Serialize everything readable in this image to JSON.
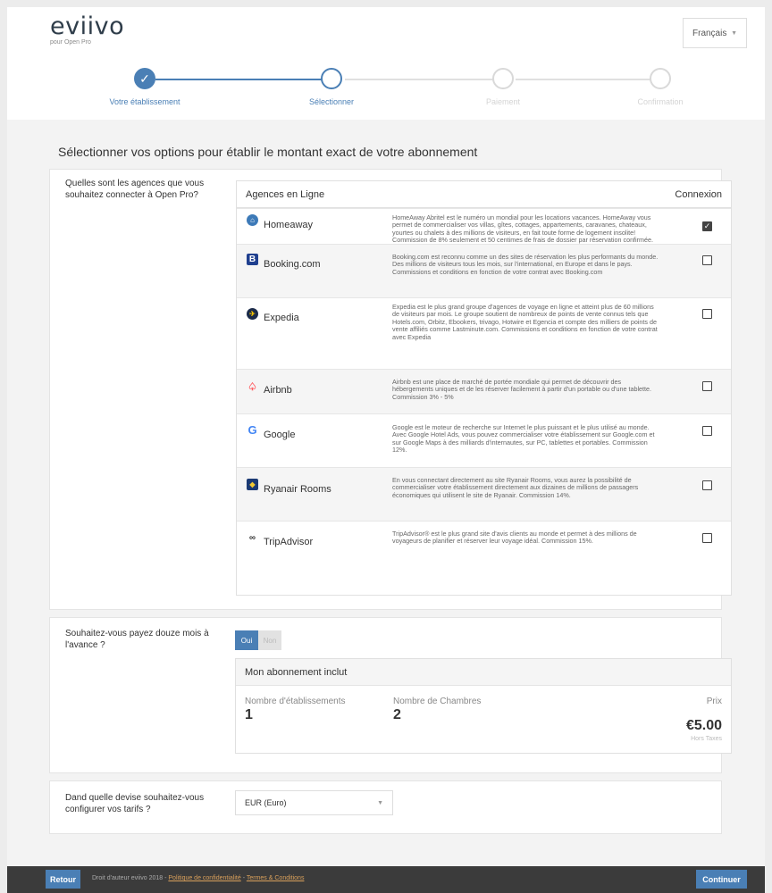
{
  "header": {
    "logo": "eviivo",
    "logo_sub": "pour Open Pro",
    "language": "Français"
  },
  "stepper": {
    "steps": [
      {
        "label": "Votre établissement",
        "state": "done"
      },
      {
        "label": "Sélectionner",
        "state": "active"
      },
      {
        "label": "Paiement",
        "state": "todo"
      },
      {
        "label": "Confirmation",
        "state": "todo"
      }
    ],
    "accent_color": "#4a7fb5"
  },
  "page_title": "Sélectionner vos options pour établir le montant exact de votre abonnement",
  "agencies": {
    "question": "Quelles sont les agences que vous souhaitez connecter à Open Pro?",
    "header_name": "Agences en Ligne",
    "header_connect": "Connexion",
    "items": [
      {
        "name": "Homeaway",
        "icon": "homeaway-icon",
        "checked": true,
        "description": "HomeAway Abritel est le numéro un mondial pour les locations vacances. HomeAway vous permet de commercialiser vos villas, gîtes, cottages, appartements, caravanes, chateaux, yourtes ou chalets à des millions de visiteurs, en fait toute forme de logement insolite! Commission de 8% seulement et 50 centimes de frais de dossier par réservation confirmée."
      },
      {
        "name": "Booking.com",
        "icon": "booking-icon",
        "checked": false,
        "description": "Booking.com est reconnu comme un des sites de réservation les plus performants du monde. Des millions de visiteurs tous les mois, sur l'international, en Europe et dans le pays. Commissions et conditions en fonction de votre contrat avec Booking.com"
      },
      {
        "name": "Expedia",
        "icon": "expedia-icon",
        "checked": false,
        "description": "Expedia est le plus grand groupe d'agences de voyage en ligne et atteint plus de 60 millions de visiteurs par mois. Le groupe soutient de nombreux de points de vente connus tels que Hotels.com, Orbitz, Ebookers, trivago, Hotwire et Egencia et compte des milliers de points de vente affiliés comme Lastminute.com. Commissions et conditions en fonction de votre contrat avec Expedia"
      },
      {
        "name": "Airbnb",
        "icon": "airbnb-icon",
        "checked": false,
        "description": "Airbnb est une place de marché de portée mondiale qui permet de découvrir des hébergements uniques et de les réserver facilement à partir d'un portable ou d'une tablette. Commission 3% - 5%"
      },
      {
        "name": "Google",
        "icon": "google-icon",
        "checked": false,
        "description": "Google est le moteur de recherche sur Internet le plus puissant et le plus utilisé au monde. Avec Google Hotel Ads, vous pouvez commercialiser votre établissement sur Google.com et sur Google Maps à des milliards d'internautes, sur PC, tablettes et portables. Commission 12%."
      },
      {
        "name": "Ryanair Rooms",
        "icon": "ryanair-icon",
        "checked": false,
        "description": "En vous connectant directement au site Ryanair Rooms, vous aurez la possibilité de commercialiser votre établissement directement aux dizaines de millions de passagers économiques qui utilisent le site de Ryanair. Commission 14%."
      },
      {
        "name": "TripAdvisor",
        "icon": "tripadvisor-icon",
        "checked": false,
        "description": "TripAdvisor® est le plus grand site d'avis clients au monde et permet à des millions de voyageurs de planifier et réserver leur voyage idéal. Commission 15%."
      }
    ]
  },
  "prepay": {
    "question": "Souhaitez-vous payez douze mois à l'avance ?",
    "yes": "Oui",
    "no": "Non",
    "subscription_title": "Mon abonnement inclut",
    "establishments_label": "Nombre d'établissements",
    "establishments_value": "1",
    "rooms_label": "Nombre de Chambres",
    "rooms_value": "2",
    "price_label": "Prix",
    "price_value": "€5.00",
    "price_note": "Hors Taxes"
  },
  "currency": {
    "question": "Dand quelle devise souhaitez-vous configurer vos tarifs ?",
    "selected": "EUR (Euro)"
  },
  "footer": {
    "back": "Retour",
    "copyright": "Droit d'auteur eviivo 2018 -",
    "privacy": "Politique de confidentialité",
    "separator": "-",
    "terms": "Termes & Conditions",
    "continue": "Continuer"
  }
}
